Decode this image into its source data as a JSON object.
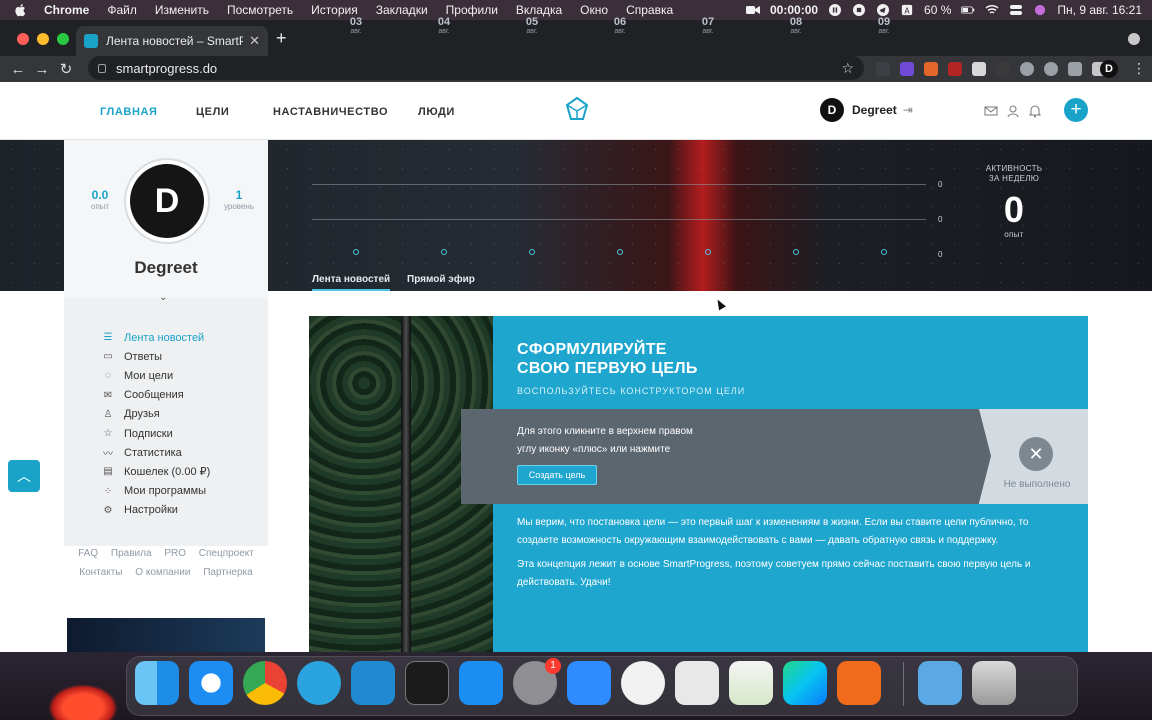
{
  "menubar": {
    "app": "Chrome",
    "items": [
      "Файл",
      "Изменить",
      "Посмотреть",
      "История",
      "Закладки",
      "Профили",
      "Вкладка",
      "Окно",
      "Справка"
    ],
    "timer": "00:00:00",
    "battery": "60 %",
    "datetime": "Пн, 9 авг.  16:21"
  },
  "browser": {
    "tab_title": "Лента новостей – SmartProgress",
    "url": "smartprogress.do",
    "profile_initial": "D"
  },
  "site": {
    "nav": [
      "ГЛАВНАЯ",
      "ЦЕЛИ",
      "НАСТАВНИЧЕСТВО",
      "ЛЮДИ"
    ],
    "user_name": "Degreet",
    "user_initial": "D"
  },
  "banner": {
    "days": [
      {
        "num": "03",
        "month": "авг."
      },
      {
        "num": "04",
        "month": "авг."
      },
      {
        "num": "05",
        "month": "авг."
      },
      {
        "num": "06",
        "month": "авг."
      },
      {
        "num": "07",
        "month": "авг."
      },
      {
        "num": "08",
        "month": "авг."
      },
      {
        "num": "09",
        "month": "авг."
      }
    ],
    "grid_values": [
      "0",
      "0",
      "0"
    ],
    "activity_label_1": "АКТИВНОСТЬ",
    "activity_label_2": "ЗА НЕДЕЛЮ",
    "activity_value": "0",
    "activity_unit": "опыт",
    "tabs": [
      "Лента новостей",
      "Прямой эфир"
    ]
  },
  "profile": {
    "initial": "D",
    "name": "Degreet",
    "xp_value": "0.0",
    "xp_label": "опыт",
    "level_value": "1",
    "level_label": "уровень"
  },
  "sidebar": {
    "items": [
      {
        "label": "Лента новостей",
        "icon": "list-icon"
      },
      {
        "label": "Ответы",
        "icon": "chat-icon"
      },
      {
        "label": "Мои цели",
        "icon": "target-icon"
      },
      {
        "label": "Сообщения",
        "icon": "mail-icon"
      },
      {
        "label": "Друзья",
        "icon": "person-icon"
      },
      {
        "label": "Подписки",
        "icon": "star-icon"
      },
      {
        "label": "Статистика",
        "icon": "chart-icon"
      },
      {
        "label": "Кошелек (0.00 ₽)",
        "icon": "wallet-icon"
      },
      {
        "label": "Мои программы",
        "icon": "programs-icon"
      },
      {
        "label": "Настройки",
        "icon": "gear-icon"
      }
    ],
    "footer_links": [
      "FAQ",
      "Правила",
      "PRO",
      "Спецпроект",
      "Контакты",
      "О компании",
      "Партнерка"
    ]
  },
  "goal": {
    "title_1": "СФОРМУЛИРУЙТЕ",
    "title_2": "СВОЮ ПЕРВУЮ ЦЕЛЬ",
    "hint": "ВОСПОЛЬЗУЙТЕСЬ КОНСТРУКТОРОМ ЦЕЛИ",
    "task_text_1": "Для этого кликните в верхнем правом",
    "task_text_2": "углу иконку «плюс» или нажмите",
    "create_button": "Создать цель",
    "status": "Не выполнено",
    "para_1_line_1": "Мы верим, что постановка цели — это первый шаг к изменениям в жизни. Если вы ставите цели публично, то",
    "para_1_line_2": "создаете возможность окружающим взаимодействовать с вами — давать обратную связь и поддержку.",
    "para_2_line_1": "Эта концепция лежит в основе SmartProgress, поэтому советуем прямо сейчас поставить свою первую цель и",
    "para_2_line_2": "действовать. Удачи!"
  },
  "dock": {
    "badge_count": "1",
    "apps": [
      "Finder",
      "Safari",
      "Chrome",
      "Telegram",
      "VS Code",
      "Terminal",
      "App Store",
      "System Preferences",
      "Zoom",
      "MongoDB Compass",
      "Screenshot",
      "Numbers",
      "WebStorm",
      "Screen Recorder",
      "Downloads",
      "Trash"
    ]
  },
  "colors": {
    "accent": "#1aa3c9",
    "goal_panel": "#1fa6cf",
    "task_dark": "#5c666f"
  }
}
